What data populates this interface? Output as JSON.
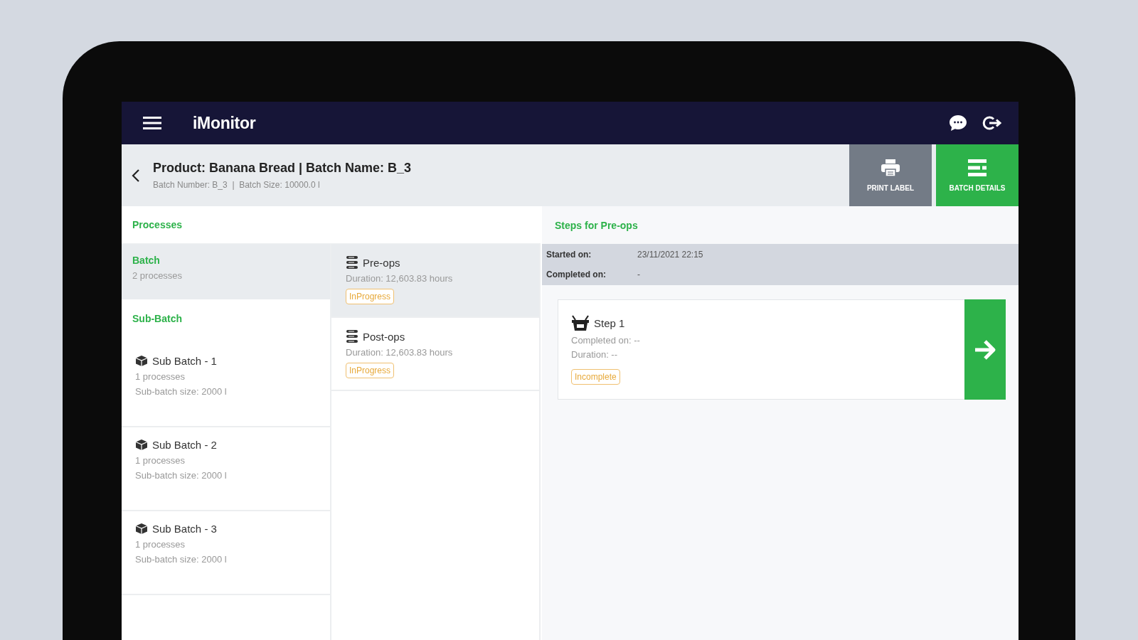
{
  "app_bar": {
    "title": "iMonitor"
  },
  "header": {
    "title": "Product: Banana Bread | Batch Name: B_3",
    "subtitle": "Batch Number: B_3  |  Batch Size: 10000.0 l",
    "actions": [
      {
        "kind": "print",
        "label": "PRINT LABEL"
      },
      {
        "kind": "details",
        "label": "BATCH DETAILS"
      }
    ]
  },
  "processes": {
    "heading": "Processes",
    "batch": {
      "title": "Batch",
      "count": "2 processes",
      "selected": true
    },
    "sub_batch_heading": "Sub-Batch",
    "sub_batches": [
      {
        "name": "Sub Batch - 1",
        "count": "1 processes",
        "size": "Sub-batch size: 2000 l",
        "selected": false
      },
      {
        "name": "Sub Batch - 2",
        "count": "1 processes",
        "size": "Sub-batch size: 2000 l",
        "selected": false
      },
      {
        "name": "Sub Batch - 3",
        "count": "1 processes",
        "size": "Sub-batch size: 2000 l",
        "selected": false
      }
    ],
    "process_list": [
      {
        "name": "Pre-ops",
        "duration": "Duration: 12,603.83 hours",
        "status": "InProgress",
        "selected": true
      },
      {
        "name": "Post-ops",
        "duration": "Duration: 12,603.83 hours",
        "status": "InProgress",
        "selected": false
      }
    ]
  },
  "steps": {
    "heading": "Steps for Pre-ops",
    "started_label": "Started on:",
    "started_value": "23/11/2021 22:15",
    "completed_label": "Completed on:",
    "completed_value": "-",
    "items": [
      {
        "name": "Step 1",
        "completed": "Completed on: --",
        "duration": "Duration: --",
        "status": "Incomplete"
      }
    ]
  }
}
